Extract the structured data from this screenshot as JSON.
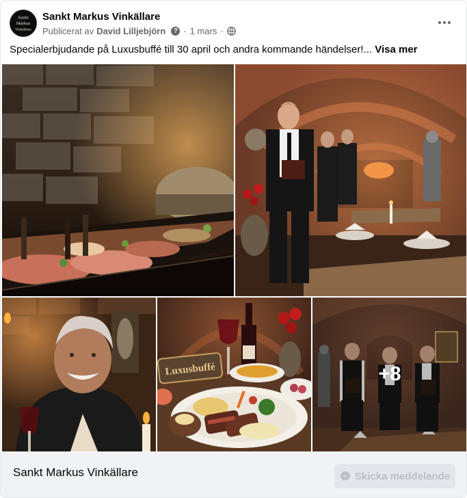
{
  "page": {
    "name": "Sankt Markus Vinkällare",
    "avatar_text": [
      "Sankt",
      "Markus",
      "Vinkällare"
    ]
  },
  "meta": {
    "published_by_prefix": "Publicerat av",
    "author": "David Lilljebjörn",
    "help_symbol": "?",
    "separator": "·",
    "date": "1 mars",
    "audience_icon": "globe-icon"
  },
  "post": {
    "text": "Specialerbjudande på Luxusbuffé till 30 april och andra kommande händelser!...",
    "see_more": "Visa mer"
  },
  "photos": {
    "sign_text": "Luxusbuffé",
    "more_count": "+8",
    "items": [
      "buffet-photo",
      "waiter-dining-room-photo",
      "smiling-guest-photo",
      "steak-plate-photo",
      "staff-photo"
    ]
  },
  "footer": {
    "name": "Sankt Markus Vinkällare",
    "send_button": "Skicka meddelande",
    "send_icon": "messenger-icon"
  },
  "colors": {
    "secondary_text": "#65676b",
    "footer_bg": "#f0f2f5",
    "button_bg": "#e4e6eb",
    "button_text": "#bcc0c4"
  }
}
